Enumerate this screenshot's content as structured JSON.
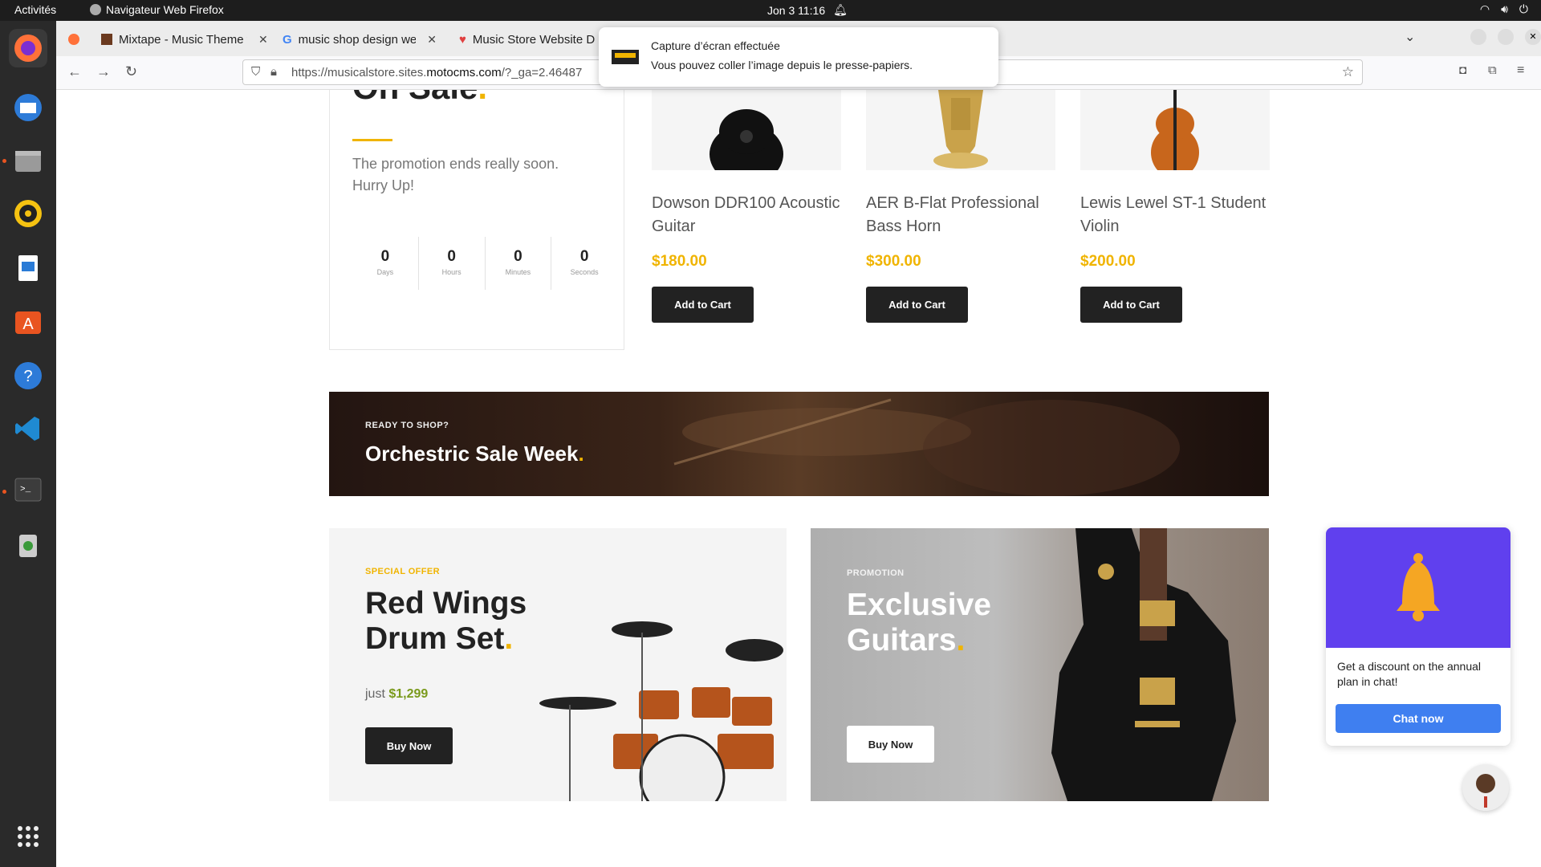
{
  "topbar": {
    "activities": "Activités",
    "app": "Navigateur Web Firefox",
    "datetime": "Jon 3  11:16"
  },
  "tabs": [
    {
      "label": "Mixtape - Music Theme f"
    },
    {
      "label": "music shop design web -"
    },
    {
      "label": "Music Store Website D"
    }
  ],
  "url": {
    "prefix": "https://musicalstore.sites.",
    "domain": "motocms.com",
    "suffix": "/?_ga=2.46487"
  },
  "notification": {
    "title": "Capture d’écran effectuée",
    "body": "Vous pouvez coller l’image depuis le presse-papiers."
  },
  "sale": {
    "title": "On Sale",
    "text": "The promotion ends really soon. Hurry Up!",
    "countdown": [
      {
        "value": "0",
        "label": "Days"
      },
      {
        "value": "0",
        "label": "Hours"
      },
      {
        "value": "0",
        "label": "Minutes"
      },
      {
        "value": "0",
        "label": "Seconds"
      }
    ]
  },
  "products": [
    {
      "name": "Dowson DDR100 Acoustic Guitar",
      "price": "$180.00",
      "button": "Add to Cart"
    },
    {
      "name": "AER B-Flat Professional Bass Horn",
      "price": "$300.00",
      "button": "Add to Cart"
    },
    {
      "name": "Lewis Lewel ST-1 Student Violin",
      "price": "$200.00",
      "button": "Add to Cart"
    }
  ],
  "banner": {
    "kicker": "READY TO SHOP?",
    "title": "Orchestric Sale Week"
  },
  "promo_left": {
    "kicker": "SPECIAL OFFER",
    "title": "Red Wings Drum Set",
    "price_prefix": "just",
    "price": "$1,299",
    "button": "Buy Now"
  },
  "promo_right": {
    "kicker": "PROMOTION",
    "title": "Exclusive Guitars",
    "button": "Buy Now"
  },
  "chat": {
    "text": "Get a discount on the annual plan in chat!",
    "button": "Chat now"
  },
  "colors": {
    "accent": "#f0b400",
    "chat_header": "#6040ee",
    "chat_button": "#3f7ff0"
  }
}
